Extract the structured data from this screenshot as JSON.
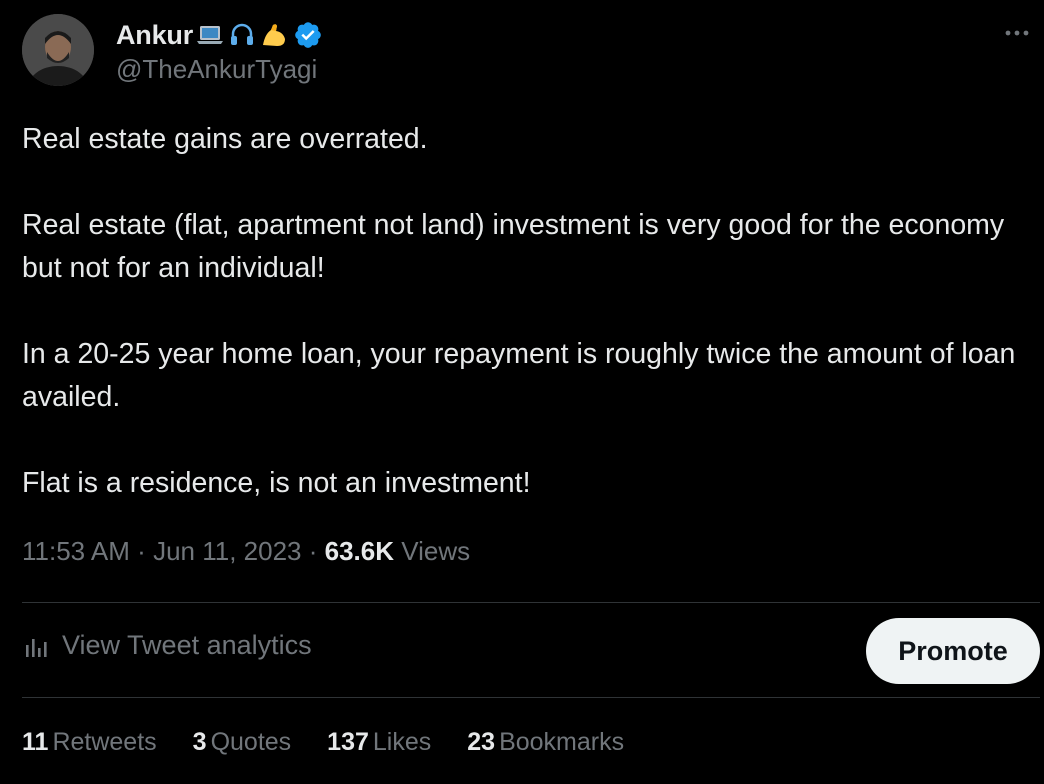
{
  "author": {
    "display_name": "Ankur",
    "handle": "@TheAnkurTyagi",
    "emojis": [
      "laptop-emoji",
      "headphone-emoji",
      "flexed-biceps-emoji"
    ],
    "verified": true,
    "verified_color": "#1d9bf0"
  },
  "tweet": {
    "paragraphs": [
      "Real estate gains are overrated.",
      "Real estate (flat, apartment not land) investment is very good for the economy but not for an individual!",
      "In a 20-25 year home loan, your repayment is roughly twice the amount of loan availed.",
      "Flat is a residence, is not an investment!"
    ],
    "time": "11:53 AM",
    "date": "Jun 11, 2023",
    "views_count": "63.6K",
    "views_label": "Views",
    "separator": "·"
  },
  "actions": {
    "analytics_label": "View Tweet analytics",
    "promote_label": "Promote"
  },
  "stats": [
    {
      "count": "11",
      "label": "Retweets"
    },
    {
      "count": "3",
      "label": "Quotes"
    },
    {
      "count": "137",
      "label": "Likes"
    },
    {
      "count": "23",
      "label": "Bookmarks"
    }
  ],
  "colors": {
    "background": "#000000",
    "text": "#e7e9ea",
    "secondary": "#71767b",
    "divider": "#2f3336",
    "promote_bg": "#eff3f4"
  }
}
